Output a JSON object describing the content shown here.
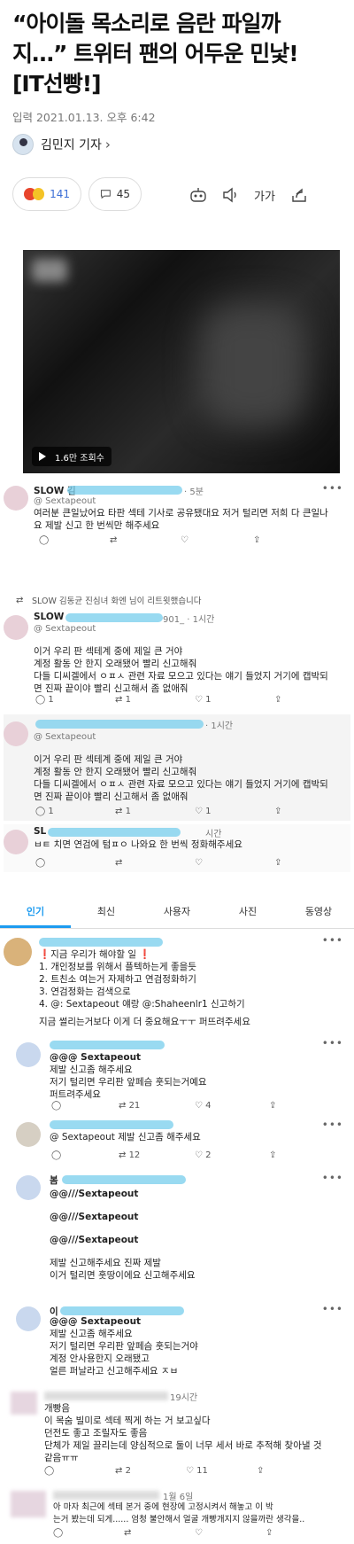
{
  "article": {
    "headline_lines": [
      "“아이돌 목소리로 음란 파일까",
      "지…” 트위터 팬의 어두운 민낯!",
      "[IT선빵!]"
    ],
    "date": "입력 2021.01.13. 오후 6:42",
    "reporter": "김민지 기자",
    "reaction_count": "141",
    "comment_count": "45",
    "font_label": "가가",
    "video_views": "1.6만 조회수"
  },
  "tweets": {
    "t1": {
      "name": "SLOW 김",
      "time": "· 5분",
      "handle": "@ Sextapeout",
      "lines": [
        "여러분 큰일났어요 타판 섹테 기사로 공유됐대요 저거 털리면 저희 다 큰일나",
        "요 제발 신고 한 번씩만 해주세요"
      ]
    },
    "retweet_note": "SLOW 김동균 진심녀 화엔 님이 리트윗했습니다",
    "t2": {
      "name": "SLOW",
      "time": "901_ · 1시간",
      "handle": "@ Sextapeout",
      "lines": [
        "이거 우리 판 섹테계 중에 제일 큰 거야",
        "계정 활동 안 한지 오래됐어 빨리 신고해줘",
        "다들 디씨겔에서 ㅇㅍㅅ 관련 자료 모으고 있다는 얘기 들었지 거기에 캡박되",
        "면 진짜 끝이야 빨리 신고해서 좀 없애줘"
      ],
      "reply_count": "1",
      "rt_count": "1",
      "like_count": "1"
    },
    "t3": {
      "time": "· 1시간",
      "handle": "@ Sextapeout",
      "lines": [
        "이거 우리 판 섹테계 중에 제일 큰 거야",
        "계정 활동 안 한지 오래됐어 빨리 신고해줘",
        "다들 디씨겔에서 ㅇㅍㅅ 관련 자료 모으고 있다는 얘기 들었지 거기에 캡박되",
        "면 진짜 끝이야 빨리 신고해서 좀 없애줘"
      ],
      "reply_count": "1",
      "rt_count": "1",
      "like_count": "1"
    },
    "t4": {
      "name": "SL",
      "time": "시간",
      "line": "ㅂㅌ 치면 연검에 텀ㅍㅇ 나와요 한 번씩 정화해주세요"
    }
  },
  "tabs": [
    "인기",
    "최신",
    "사용자",
    "사진",
    "동영상"
  ],
  "comments": {
    "c1": {
      "lines": [
        "❗지금 우리가 해야할 일 ❗",
        "1. 개인정보를 위해서 플텍하는게 좋을듯",
        "2. 트친소 여는거 자제하고 연검정화하기",
        "3. 연검정화는 검색으로",
        "4. @: Sextapeout 얘랑 @:Shaheenlr1 신고하기",
        "지금 썰리는거보다 이게 더 중요해요ㅜㅜ 퍼뜨려주세요"
      ]
    },
    "c2": {
      "reply": "@@@ Sextapeout",
      "lines": [
        "제발 신고좀 해주세요",
        "저기 털리면 우리판 앞페슴 훗되는거예요",
        "퍼트려주세요"
      ],
      "rt_count": "21",
      "like_count": "4"
    },
    "c3": {
      "line": "@ Sextapeout 제발 신고좀 해주세요",
      "rt_count": "12",
      "like_count": "2"
    },
    "c4": {
      "name": "봄",
      "lines": [
        "@@///Sextapeout",
        "@@///Sextapeout",
        "@@///Sextapeout",
        "제발 신고해주세요 진짜 제발",
        "이거 털리면 훗땅이에요 신고해주세요"
      ]
    },
    "c5": {
      "name": "이",
      "reply": "@@@ Sextapeout",
      "lines": [
        "제발 신고좀 해주세요",
        "저기 털리면 우리판 앞페슴 훗되는거야",
        "계정 안사용한지 오래됐고",
        "얼른 퍼날라고 신고해주세요 ㅈㅂ"
      ]
    },
    "c6": {
      "time": "19시간",
      "lines": [
        "개빵음",
        "이 목숨 빌미로 섹테 찍게 하는 거 보고싶다",
        "던전도 좋고 조릴자도 좋음",
        "단체가 제일 끌리는데 양심적으로 둘이 너무 세서 바로 추적해 찾아낼 것",
        "같음ㅠㅠ"
      ],
      "rt_count": "2",
      "like_count": "11"
    },
    "c7": {
      "time": "1월 6일",
      "lines": [
        "아 마자 최근에 섹테 본거 중에 현장에 고정시켜서 해놓고 이 박",
        "는거 봤는데 되게...... 엄청 불안해서 얼굴 개빵개지지 않을까란 생각을.."
      ]
    }
  }
}
